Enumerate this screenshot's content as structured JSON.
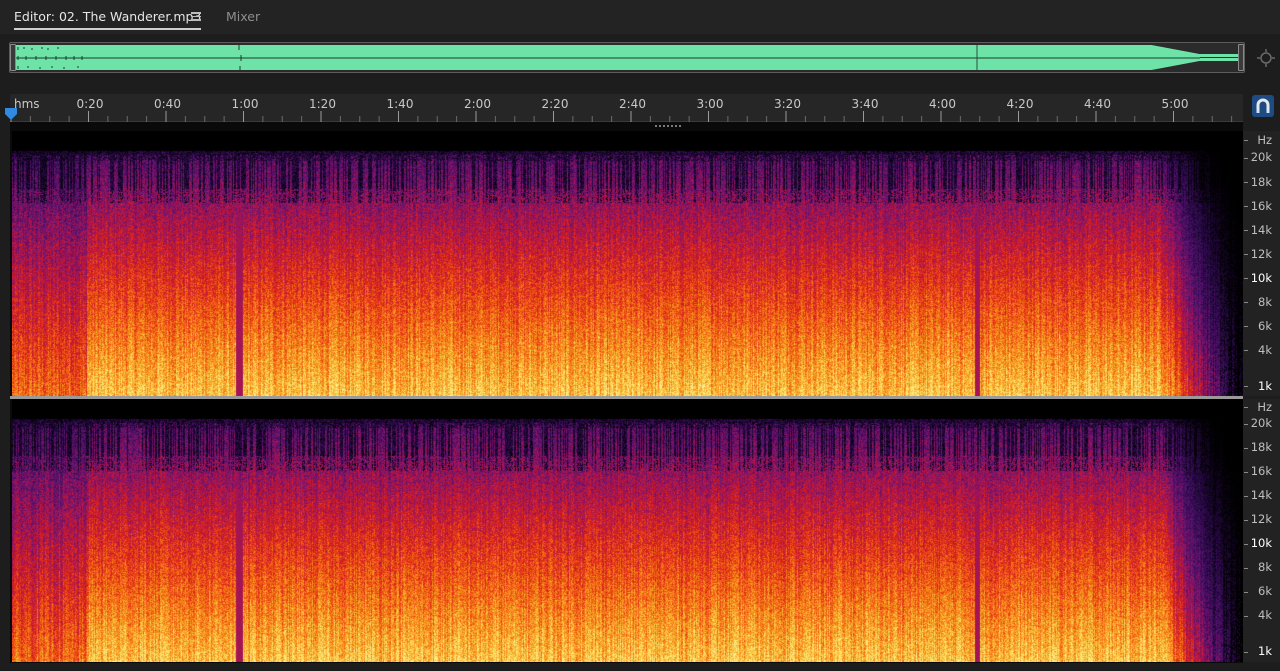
{
  "tabs": {
    "editor_label": "Editor: 02. The Wanderer.mp3",
    "mixer_label": "Mixer",
    "menu_icon": "hamburger-menu-icon"
  },
  "overview": {
    "wave_color": "#6ee3a8",
    "zoom_icon": "zoom-navigator-icon"
  },
  "ruler": {
    "units_label": "hms",
    "ticks": [
      "0:20",
      "0:40",
      "1:00",
      "1:20",
      "1:40",
      "2:00",
      "2:20",
      "2:40",
      "3:00",
      "3:20",
      "3:40",
      "4:00",
      "4:20",
      "4:40",
      "5:00"
    ],
    "playhead_icon": "playhead-marker-icon",
    "snap_icon": "snap-magnet-icon",
    "accent": "#1e4c82"
  },
  "channels": [
    {
      "unit": "Hz",
      "labels": [
        "20k",
        "18k",
        "16k",
        "14k",
        "12k",
        "10k",
        "8k",
        "6k",
        "4k",
        "1k"
      ]
    },
    {
      "unit": "Hz",
      "labels": [
        "20k",
        "18k",
        "16k",
        "14k",
        "12k",
        "10k",
        "8k",
        "6k",
        "4k",
        "1k"
      ]
    }
  ],
  "spectrogram_palette": [
    "#000000",
    "#2a0a4a",
    "#5a1270",
    "#a0145a",
    "#d81e1e",
    "#f25a12",
    "#f7a020",
    "#fbe060",
    "#fff6b0"
  ]
}
